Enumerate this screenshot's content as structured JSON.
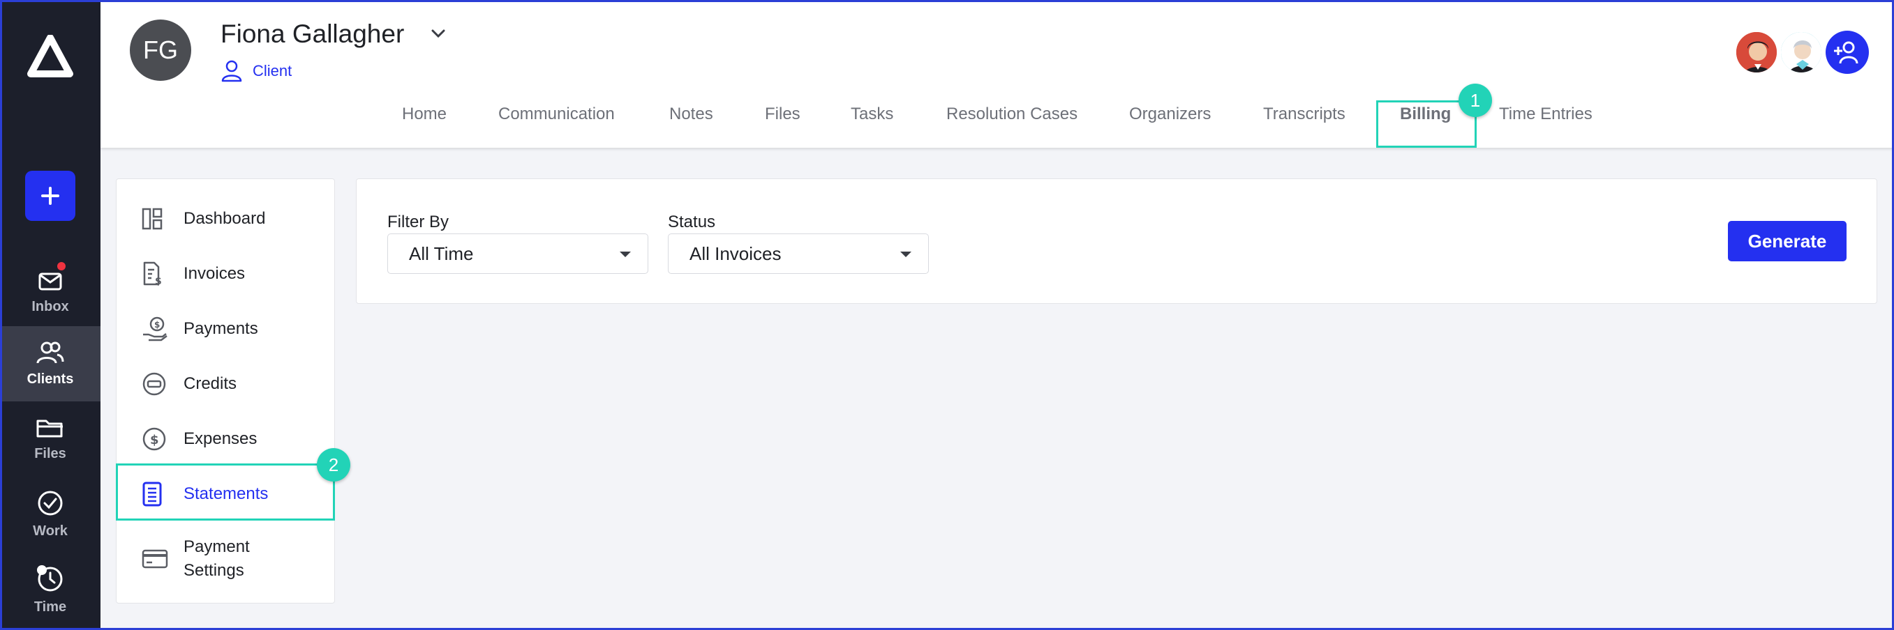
{
  "rail": {
    "items": [
      {
        "label": "Inbox",
        "icon": "mail-icon"
      },
      {
        "label": "Clients",
        "icon": "users-icon"
      },
      {
        "label": "Files",
        "icon": "folder-icon"
      },
      {
        "label": "Work",
        "icon": "check-circle-icon"
      },
      {
        "label": "Time",
        "icon": "clock-icon"
      }
    ],
    "active": "Clients"
  },
  "client": {
    "initials": "FG",
    "name": "Fiona Gallagher",
    "role": "Client"
  },
  "tabs": [
    "Home",
    "Communication",
    "Notes",
    "Files",
    "Tasks",
    "Resolution Cases",
    "Organizers",
    "Transcripts",
    "Billing",
    "Time Entries"
  ],
  "active_tab": "Billing",
  "annotations": {
    "tab_badge": "1",
    "side_badge": "2"
  },
  "side_menu": {
    "items": [
      {
        "label": "Dashboard",
        "icon": "dashboard-icon"
      },
      {
        "label": "Invoices",
        "icon": "invoice-icon"
      },
      {
        "label": "Payments",
        "icon": "payment-hand-icon"
      },
      {
        "label": "Credits",
        "icon": "credit-icon"
      },
      {
        "label": "Expenses",
        "icon": "dollar-circle-icon"
      },
      {
        "label": "Statements",
        "icon": "statement-icon"
      },
      {
        "label": "Payment Settings",
        "icon": "card-icon"
      }
    ],
    "active": "Statements"
  },
  "filters": {
    "filter_by_label": "Filter By",
    "filter_by_value": "All Time",
    "status_label": "Status",
    "status_value": "All Invoices"
  },
  "generate_label": "Generate",
  "colors": {
    "accent": "#2430f0",
    "highlight": "#22d3b7",
    "rail": "#1c1f2b"
  }
}
